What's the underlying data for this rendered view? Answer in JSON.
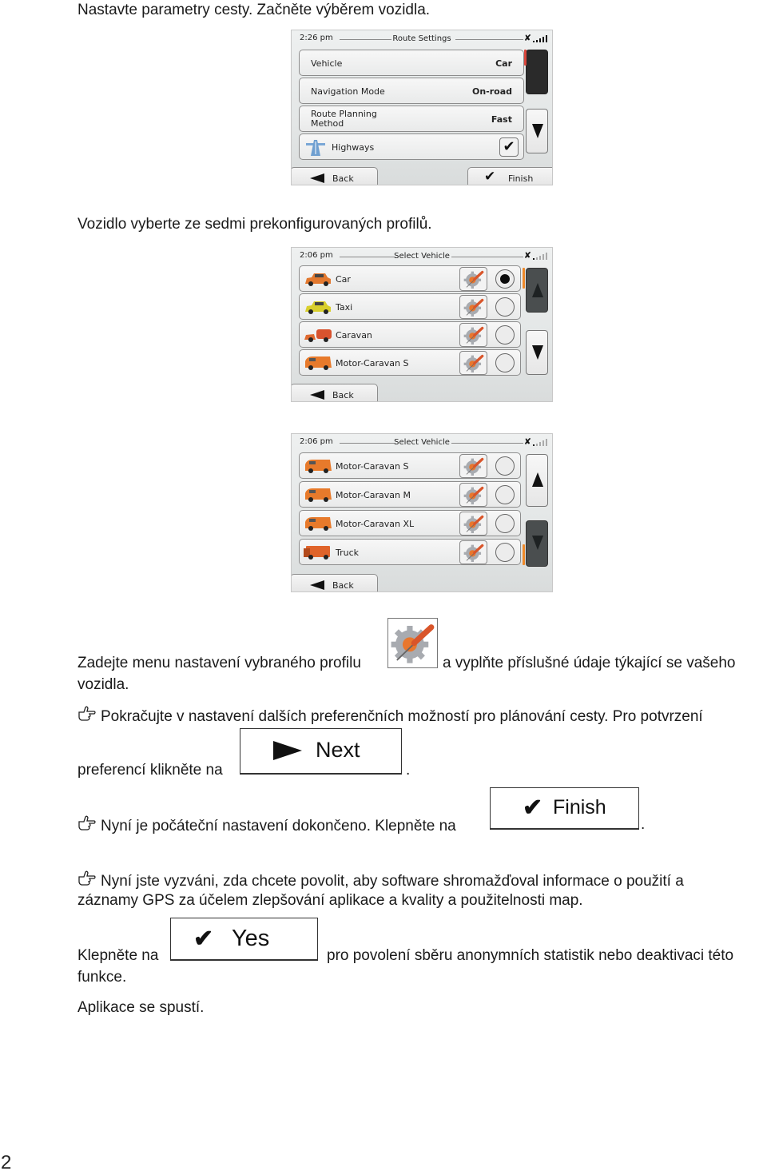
{
  "doc": {
    "intro": "Nastavte parametry cesty. Začněte výběrem vozidla.",
    "vehicle_intro": "Vozidlo vyberte ze sedmi prekonfigurovaných profilů.",
    "settings_text_before": "Zadejte menu nastavení vybraného profilu",
    "settings_text_after": "a vyplňte příslušné údaje týkající se vašeho",
    "settings_text_wrap": "vozidla.",
    "continue_text": "Pokračujte v nastavení dalších preferenčních možností pro plánování cesty. Pro potvrzení",
    "continue_text_wrap": "preferencí klikněte na",
    "period": ".",
    "done_text": "Nyní je počáteční nastavení dokončeno. Klepněte na",
    "consent_text_1": "Nyní jste vyzváni, zda chcete povolit, aby software shromažďoval informace o použití a",
    "consent_text_2": "záznamy GPS za účelem zlepšování aplikace a kvality a použitelnosti map.",
    "yes_before": "Klepněte na",
    "yes_after": "pro povolení sběru anonymních statistik nebo deaktivaci této",
    "yes_wrap": "funkce.",
    "launch_text": "Aplikace se spustí.",
    "page_number": "2",
    "buttons": {
      "next": "Next",
      "finish": "Finish",
      "yes": "Yes"
    },
    "icons": {
      "hand": "pointing-hand-icon",
      "settings": "vehicle-settings-icon"
    }
  },
  "screen_route": {
    "time": "2:26 pm",
    "title": "Route Settings",
    "rows": [
      {
        "label": "Vehicle",
        "value": "Car"
      },
      {
        "label": "Navigation Mode",
        "value": "On-road"
      },
      {
        "label_line1": "Route Planning",
        "label_line2": "Method",
        "value": "Fast"
      },
      {
        "label": "Highways",
        "checked": true
      }
    ],
    "back": "Back",
    "finish": "Finish"
  },
  "screen_vehicle_1": {
    "time": "2:06 pm",
    "title": "Select Vehicle",
    "vehicles": [
      {
        "name": "Car",
        "selected": true,
        "color": "#e2782e"
      },
      {
        "name": "Taxi",
        "selected": false,
        "color": "#d9cf2c"
      },
      {
        "name": "Caravan",
        "selected": false,
        "color": "#e06a30"
      },
      {
        "name": "Motor-Caravan S",
        "selected": false,
        "color": "#e77a2b"
      }
    ],
    "back": "Back"
  },
  "screen_vehicle_2": {
    "time": "2:06 pm",
    "title": "Select Vehicle",
    "vehicles": [
      {
        "name": "Motor-Caravan S",
        "selected": false,
        "color": "#e77a2b"
      },
      {
        "name": "Motor-Caravan M",
        "selected": false,
        "color": "#e77a2b"
      },
      {
        "name": "Motor-Caravan XL",
        "selected": false,
        "color": "#e77a2b"
      },
      {
        "name": "Truck",
        "selected": false,
        "color": "#e0642a"
      }
    ],
    "back": "Back"
  },
  "colors": {
    "scroll_red": "#d9463c",
    "scroll_orange": "#f08a2a",
    "accent_orange": "#e8772e"
  }
}
